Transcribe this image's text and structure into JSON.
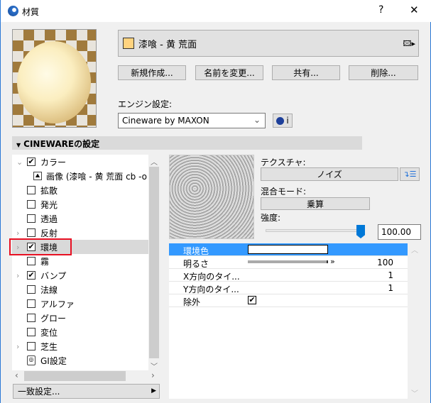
{
  "window": {
    "title": "材質",
    "help": "?",
    "close": "✕"
  },
  "material": {
    "name": "漆喰 - 黄 荒面",
    "swatch_color": "#ffd37f"
  },
  "buttons": {
    "new": "新規作成...",
    "rename": "名前を変更...",
    "share": "共有...",
    "delete": "削除..."
  },
  "engine": {
    "label": "エンジン設定:",
    "value": "Cineware by MAXON",
    "info": "i"
  },
  "section": {
    "title": "CINEWAREの設定"
  },
  "tree": [
    {
      "label": "カラー",
      "checked": true,
      "expander": "expanded"
    },
    {
      "label": "画像 (漆喰 - 黄 荒面 cb -o",
      "child": true
    },
    {
      "label": "拡散",
      "checked": false
    },
    {
      "label": "発光",
      "checked": false
    },
    {
      "label": "透過",
      "checked": false
    },
    {
      "label": "反射",
      "checked": false,
      "expander": "collapsed"
    },
    {
      "label": "環境",
      "checked": true,
      "expander": "collapsed",
      "selected": true
    },
    {
      "label": "霧",
      "checked": false
    },
    {
      "label": "バンプ",
      "checked": true,
      "expander": "collapsed"
    },
    {
      "label": "法線",
      "checked": false
    },
    {
      "label": "アルファ",
      "checked": false
    },
    {
      "label": "グロー",
      "checked": false
    },
    {
      "label": "変位",
      "checked": false
    },
    {
      "label": "芝生",
      "checked": false,
      "expander": "collapsed"
    },
    {
      "label": "GI設定",
      "gi": true
    }
  ],
  "match_button": "一致設定...",
  "texture": {
    "label": "テクスチャ:",
    "value": "ノイズ",
    "blend_label": "混合モード:",
    "blend_value": "乗算",
    "strength_label": "強度:",
    "strength_value": "100.00",
    "strength_percent": 100
  },
  "props": [
    {
      "name": "環境色",
      "type": "color",
      "color": "#ffffff"
    },
    {
      "name": "明るさ",
      "type": "slider",
      "value": "100"
    },
    {
      "name": "X方向のタイ...",
      "value": "1"
    },
    {
      "name": "Y方向のタイ...",
      "value": "1"
    },
    {
      "name": "除外",
      "type": "check",
      "checked": true
    }
  ],
  "colors": {
    "accent": "#3399ff",
    "highlight_box": "#e81123",
    "slider_thumb": "#0078d7"
  }
}
